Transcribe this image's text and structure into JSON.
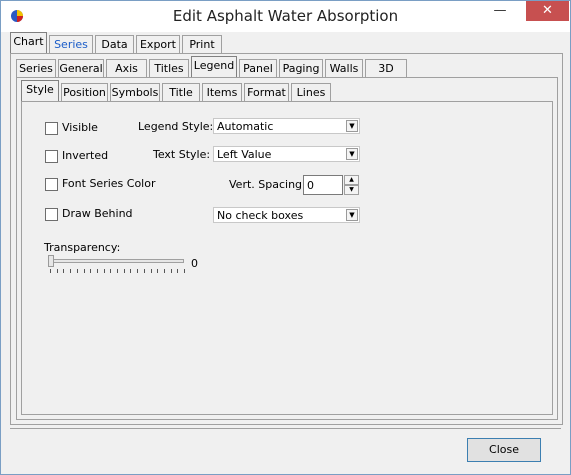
{
  "window": {
    "title": "Edit Asphalt Water Absorption"
  },
  "titlebar": {
    "minimize": "—",
    "maximize": "□",
    "close": "✕"
  },
  "main_tabs": [
    "Chart",
    "Series",
    "Data",
    "Export",
    "Print"
  ],
  "chart_tabs": [
    "Series",
    "General",
    "Axis",
    "Titles",
    "Legend",
    "Panel",
    "Paging",
    "Walls",
    "3D"
  ],
  "legend_tabs": [
    "Style",
    "Position",
    "Symbols",
    "Title",
    "Items",
    "Format",
    "Lines"
  ],
  "style": {
    "visible_label": "Visible",
    "inverted_label": "Inverted",
    "font_series_color_label": "Font Series Color",
    "draw_behind_label": "Draw Behind",
    "legend_style_label": "Legend Style:",
    "legend_style_value": "Automatic",
    "text_style_label": "Text Style:",
    "text_style_value": "Left Value",
    "vert_spacing_label": "Vert. Spacing:",
    "vert_spacing_value": "0",
    "checkbox_style_value": "No check boxes",
    "transparency_label": "Transparency:",
    "transparency_value": "0",
    "transparency_level": 0
  },
  "buttons": {
    "close": "Close"
  },
  "icons": {
    "app": "teechart-app-icon",
    "dropdown": "dropdown-arrow-icon"
  }
}
